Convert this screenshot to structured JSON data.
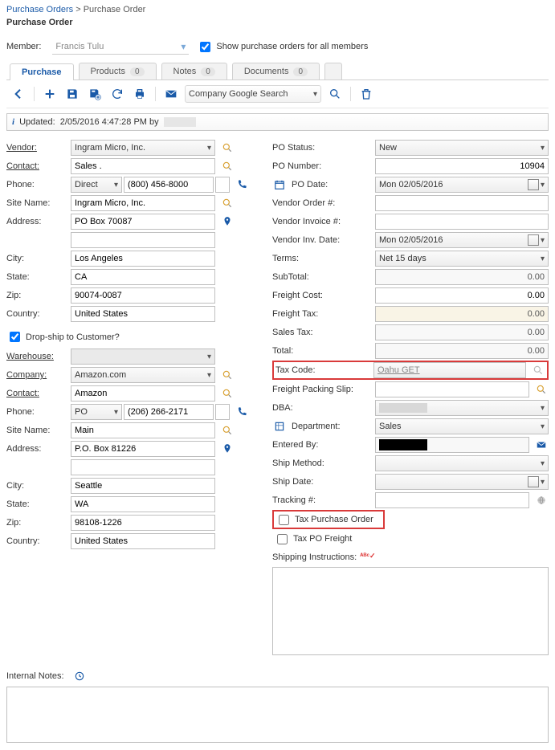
{
  "breadcrumb": {
    "root": "Purchase Orders",
    "leaf": "Purchase Order"
  },
  "page_title": "Purchase Order",
  "member": {
    "label": "Member:",
    "value": "Francis Tulu"
  },
  "show_all": {
    "label": "Show purchase orders for all members",
    "checked": true
  },
  "tabs": {
    "purchase": "Purchase",
    "products": "Products",
    "products_count": "0",
    "notes": "Notes",
    "notes_count": "0",
    "documents": "Documents",
    "documents_count": "0"
  },
  "toolbar": {
    "combo_label": "Company Google Search"
  },
  "updated": {
    "label": "Updated:",
    "value": "2/05/2016  4:47:28 PM by"
  },
  "vendor": {
    "vendor_lbl": "Vendor:",
    "vendor": "Ingram Micro, Inc.",
    "contact_lbl": "Contact:",
    "contact": "Sales .",
    "phone_lbl": "Phone:",
    "phone_type": "Direct",
    "phone": "(800) 456-8000",
    "site_lbl": "Site Name:",
    "site": "Ingram Micro, Inc.",
    "address_lbl": "Address:",
    "address": "PO Box 70087",
    "city_lbl": "City:",
    "city": "Los Angeles",
    "state_lbl": "State:",
    "state": "CA",
    "zip_lbl": "Zip:",
    "zip": "90074-0087",
    "country_lbl": "Country:",
    "country": "United States"
  },
  "dropship_lbl": "Drop-ship to Customer?",
  "ship": {
    "warehouse_lbl": "Warehouse:",
    "company_lbl": "Company:",
    "company": "Amazon.com",
    "contact_lbl": "Contact:",
    "contact": "Amazon",
    "phone_lbl": "Phone:",
    "phone_type": "PO",
    "phone": "(206) 266-2171",
    "site_lbl": "Site Name:",
    "site": "Main",
    "address_lbl": "Address:",
    "address": "P.O. Box 81226",
    "city_lbl": "City:",
    "city": "Seattle",
    "state_lbl": "State:",
    "state": "WA",
    "zip_lbl": "Zip:",
    "zip": "98108-1226",
    "country_lbl": "Country:",
    "country": "United States"
  },
  "po": {
    "status_lbl": "PO Status:",
    "status": "New",
    "number_lbl": "PO Number:",
    "number": "10904",
    "date_lbl": "PO Date:",
    "date": "Mon 02/05/2016",
    "vendorder_lbl": "Vendor Order #:",
    "vendorinv_lbl": "Vendor Invoice #:",
    "invdate_lbl": "Vendor Inv. Date:",
    "invdate": "Mon 02/05/2016",
    "terms_lbl": "Terms:",
    "terms": "Net 15 days",
    "subtotal_lbl": "SubTotal:",
    "subtotal": "0.00",
    "freightcost_lbl": "Freight Cost:",
    "freightcost": "0.00",
    "freighttax_lbl": "Freight Tax:",
    "freighttax": "0.00",
    "salestax_lbl": "Sales Tax:",
    "salestax": "0.00",
    "total_lbl": "Total:",
    "total": "0.00",
    "taxcode_lbl": "Tax Code:",
    "taxcode": "Oahu GET",
    "packslip_lbl": "Freight Packing Slip:",
    "dba_lbl": "DBA:",
    "dept_lbl": "Department:",
    "dept": "Sales",
    "enteredby_lbl": "Entered By:",
    "shipmethod_lbl": "Ship Method:",
    "shipdate_lbl": "Ship Date:",
    "tracking_lbl": "Tracking #:",
    "taxpo_lbl": "Tax Purchase Order",
    "taxfreight_lbl": "Tax PO Freight",
    "shipinstr_lbl": "Shipping Instructions:"
  },
  "notes_lbl": "Internal Notes:"
}
